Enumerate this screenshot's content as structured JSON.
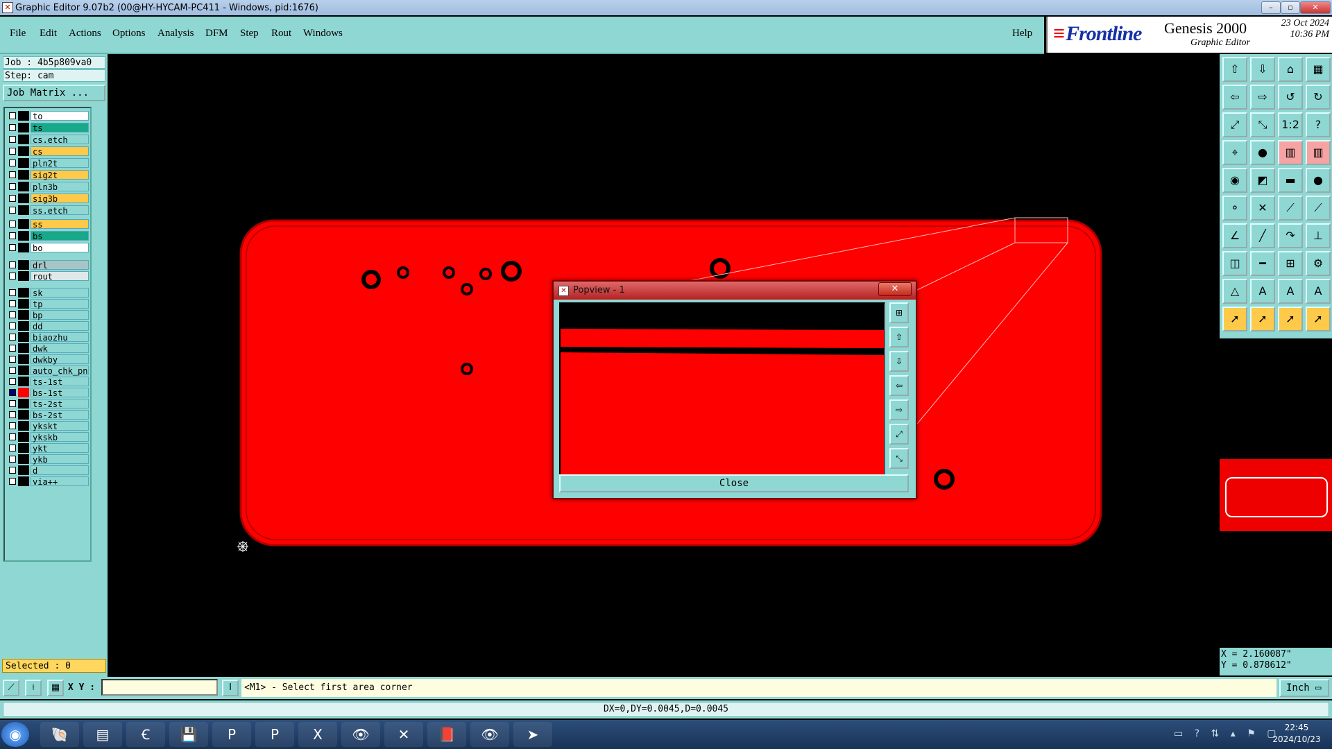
{
  "window": {
    "title": "Graphic Editor 9.07b2 (00@HY-HYCAM-PC411 - Windows, pid:1676)",
    "controls": [
      "–",
      "▫",
      "✕"
    ]
  },
  "menu": {
    "items": [
      "File",
      "Edit",
      "Actions",
      "Options",
      "Analysis",
      "DFM",
      "Step",
      "Rout",
      "Windows"
    ],
    "help": "Help"
  },
  "brand": {
    "logo": "Frontline",
    "product": "Genesis 2000",
    "subtitle": "Graphic Editor",
    "date": "23 Oct 2024",
    "time": "10:36 PM"
  },
  "job": {
    "job_line": "Job : 4b5p809va0",
    "step_line": "Step: cam",
    "matrix_button": "Job Matrix ..."
  },
  "layers": [
    {
      "name": "to",
      "color": "#ffffff"
    },
    {
      "name": "ts",
      "color": "#18a88a"
    },
    {
      "name": "cs.etch",
      "color": "#8fd7d3"
    },
    {
      "name": "cs",
      "color": "#ffc94a"
    },
    {
      "name": "pln2t",
      "color": "#8fd7d3"
    },
    {
      "name": "sig2t",
      "color": "#ffc94a"
    },
    {
      "name": "pln3b",
      "color": "#8fd7d3"
    },
    {
      "name": "sig3b",
      "color": "#ffc94a"
    },
    {
      "name": "ss.etch",
      "color": "#8fd7d3"
    },
    {
      "name": "ss",
      "color": "#ffc94a"
    },
    {
      "name": "bs",
      "color": "#18a88a"
    },
    {
      "name": "bo",
      "color": "#ffffff"
    },
    {
      "name": "drl",
      "color": "#a9c4c4"
    },
    {
      "name": "rout",
      "color": "#dfe8e8"
    },
    {
      "name": "sk",
      "color": "#8fd7d3"
    },
    {
      "name": "tp",
      "color": "#8fd7d3"
    },
    {
      "name": "bp",
      "color": "#8fd7d3"
    },
    {
      "name": "dd",
      "color": "#8fd7d3"
    },
    {
      "name": "biaozhu",
      "color": "#8fd7d3"
    },
    {
      "name": "dwk",
      "color": "#8fd7d3"
    },
    {
      "name": "dwkby",
      "color": "#8fd7d3"
    },
    {
      "name": "auto_chk_pn",
      "color": "#8fd7d3"
    },
    {
      "name": "ts-1st",
      "color": "#8fd7d3"
    },
    {
      "name": "bs-1st",
      "color": "#8fd7d3",
      "active": true
    },
    {
      "name": "ts-2st",
      "color": "#8fd7d3"
    },
    {
      "name": "bs-2st",
      "color": "#8fd7d3"
    },
    {
      "name": "ykskt",
      "color": "#8fd7d3"
    },
    {
      "name": "ykskb",
      "color": "#8fd7d3"
    },
    {
      "name": "ykt",
      "color": "#8fd7d3"
    },
    {
      "name": "ykb",
      "color": "#8fd7d3"
    },
    {
      "name": "d",
      "color": "#8fd7d3"
    },
    {
      "name": "via++",
      "color": "#8fd7d3"
    }
  ],
  "selected": "Selected : 0",
  "toolbox": [
    "⇧",
    "⇩",
    "⌂",
    "▦",
    "⇦",
    "⇨",
    "↺",
    "↻",
    "⤢",
    "⤡",
    "1:2",
    "?",
    "⌖",
    "●",
    "▥",
    "▥",
    "◉",
    "◩",
    "▬",
    "●",
    "⚬",
    "✕",
    "⟋",
    "⟋",
    "∠",
    "╱",
    "↷",
    "⊥",
    "◫",
    "━",
    "⊞",
    "⚙",
    "△",
    "A",
    "A",
    "A",
    "➚",
    "➚",
    "➚",
    "➚"
  ],
  "coords": {
    "x": "X = 2.160087\"",
    "y": "Y = 0.878612\""
  },
  "command": {
    "xy_label": "X Y :",
    "xy_value": "",
    "prompt": "<M1> - Select first area corner",
    "unit": "Inch"
  },
  "status": "DX=0,DY=0.0045,D=0.0045",
  "popup": {
    "title": "Popview - 1",
    "close_label": "Close",
    "side_buttons": [
      "⊞",
      "⇧",
      "⇩",
      "⇦",
      "⇨",
      "⤢",
      "⤡"
    ]
  },
  "taskbar": {
    "apps": [
      "◉",
      "🐚",
      "▤",
      "Ꞓ",
      "💾",
      "P",
      "P",
      "X",
      "👁",
      "✕",
      "📕",
      "👁",
      "➤"
    ],
    "time": "22:45",
    "date": "2024/10/23"
  },
  "colors": {
    "board": "#ff0000",
    "outline": "#cc0000",
    "panel": "#8fd7d3"
  }
}
